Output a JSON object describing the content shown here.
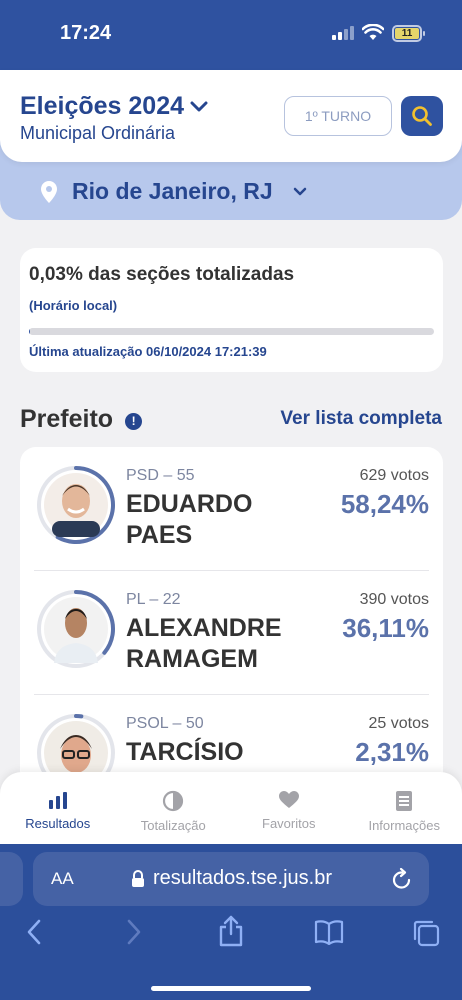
{
  "status_bar": {
    "time": "17:24",
    "battery": "11"
  },
  "header": {
    "title": "Eleições 2024",
    "subtitle": "Municipal Ordinária",
    "turno_button": "1º TURNO",
    "location": "Rio de Janeiro, RJ"
  },
  "progress": {
    "title": "0,03% das seções totalizadas",
    "local_time": "(Horário local)",
    "percent": 0.03,
    "updated": "Última atualização 06/10/2024 17:21:39"
  },
  "section": {
    "title": "Prefeito",
    "see_all": "Ver lista completa"
  },
  "candidates": [
    {
      "party": "PSD – 55",
      "name_line1": "EDUARDO",
      "name_line2": "PAES",
      "votes": "629 votos",
      "percent": "58,24%",
      "share": 0.5824
    },
    {
      "party": "PL – 22",
      "name_line1": "ALEXANDRE",
      "name_line2": "RAMAGEM",
      "votes": "390 votos",
      "percent": "36,11%",
      "share": 0.3611
    },
    {
      "party": "PSOL – 50",
      "name_line1": "TARCÍSIO",
      "name_line2": "",
      "votes": "25 votos",
      "percent": "2,31%",
      "share": 0.0231
    }
  ],
  "tabs": [
    {
      "label": "Resultados",
      "icon": "bar-chart-icon",
      "active": true
    },
    {
      "label": "Totalização",
      "icon": "pie-icon",
      "active": false
    },
    {
      "label": "Favoritos",
      "icon": "heart-icon",
      "active": false
    },
    {
      "label": "Informações",
      "icon": "document-icon",
      "active": false
    }
  ],
  "browser": {
    "text_size_label": "AA",
    "url": "resultados.tse.jus.br"
  },
  "colors": {
    "primary": "#2f52a0",
    "accent_light": "#b7c8ec",
    "percent_text": "#5b72aa"
  }
}
